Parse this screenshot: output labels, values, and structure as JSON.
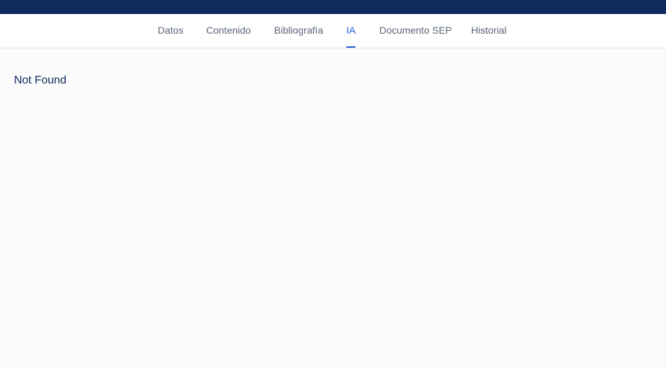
{
  "tabs": [
    {
      "label": "Datos",
      "active": false
    },
    {
      "label": "Contenido",
      "active": false
    },
    {
      "label": "Bibliografía",
      "active": false
    },
    {
      "label": "IA",
      "active": true
    },
    {
      "label": "Documento SEP",
      "active": false
    },
    {
      "label": "Historial",
      "active": false
    }
  ],
  "main": {
    "message": "Not Found"
  },
  "colors": {
    "header_bar": "#0f2a5c",
    "accent": "#1f5fd6",
    "tab_text": "#5a6478",
    "background": "#fbfbfb"
  }
}
